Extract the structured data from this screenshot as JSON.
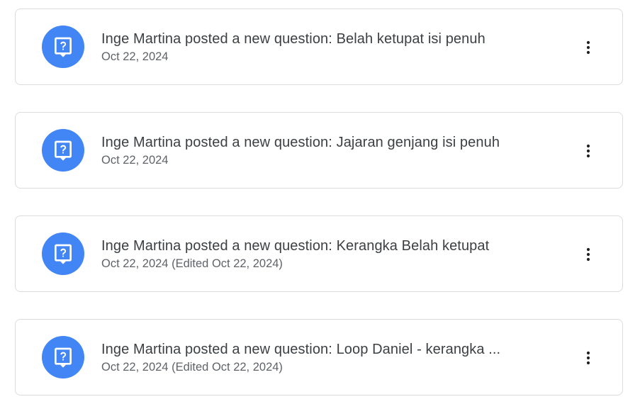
{
  "stream": {
    "items": [
      {
        "title": "Inge Martina posted a new question: Belah ketupat isi penuh",
        "date": "Oct 22, 2024",
        "edited": ""
      },
      {
        "title": "Inge Martina posted a new question: Jajaran genjang isi penuh",
        "date": "Oct 22, 2024",
        "edited": ""
      },
      {
        "title": "Inge Martina posted a new question: Kerangka Belah ketupat",
        "date": "Oct 22, 2024",
        "edited": "(Edited Oct 22, 2024)"
      },
      {
        "title": "Inge Martina posted a new question: Loop Daniel - kerangka ...",
        "date": "Oct 22, 2024",
        "edited": "(Edited Oct 22, 2024)"
      }
    ]
  },
  "icons": {
    "avatar": "question-post-icon",
    "menu": "more-vert-icon"
  },
  "colors": {
    "accent": "#4285f4",
    "title": "#3c4043",
    "secondary": "#5f6368",
    "border": "#dadce0"
  }
}
